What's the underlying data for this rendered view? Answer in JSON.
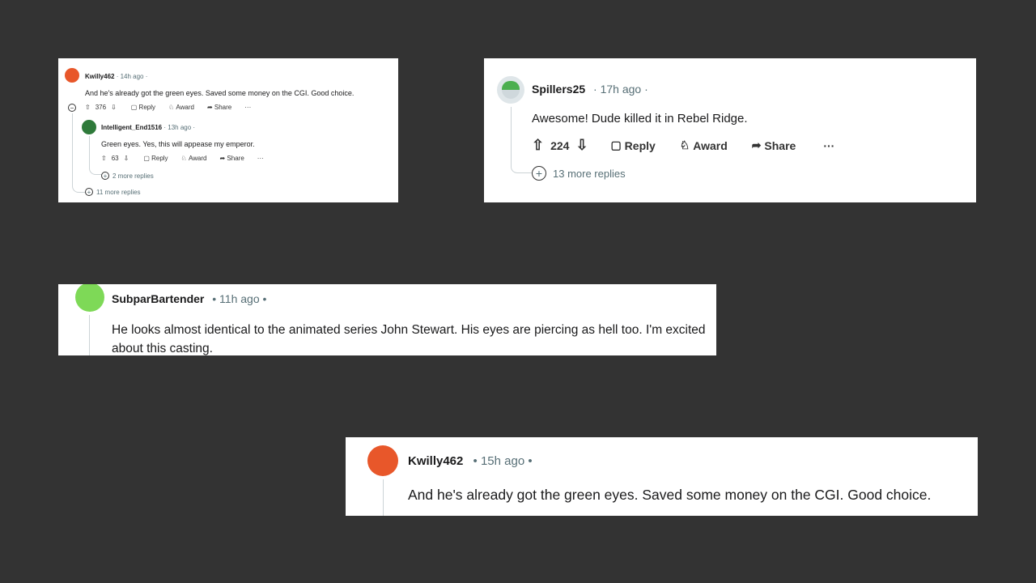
{
  "colors": {
    "background": "#333333",
    "card": "#ffffff",
    "meta": "#576f76"
  },
  "card1": {
    "comment": {
      "user": "Kwilly462",
      "time": "· 14h ago ·",
      "text": "And he's already got the green eyes. Saved some money on the CGI. Good choice.",
      "votes": "376",
      "reply": "Reply",
      "award": "Award",
      "share": "Share",
      "more": "···"
    },
    "reply": {
      "user": "Intelligent_End1516",
      "time": "· 13h ago ·",
      "text": "Green eyes. Yes, this will appease my emperor.",
      "votes": "63",
      "reply": "Reply",
      "award": "Award",
      "share": "Share",
      "more": "···",
      "more_replies": "2 more replies"
    },
    "more_replies": "11 more replies"
  },
  "card2": {
    "user": "Spillers25",
    "time": "· 17h ago ·",
    "text": "Awesome! Dude killed it in Rebel Ridge.",
    "votes": "224",
    "reply": "Reply",
    "award": "Award",
    "share": "Share",
    "more": "···",
    "more_replies": "13 more replies"
  },
  "card3": {
    "user": "SubparBartender",
    "time": "• 11h ago •",
    "text": "He looks almost identical to the animated series John Stewart. His eyes are piercing as hell too. I'm excited about this casting."
  },
  "card4": {
    "user": "Kwilly462",
    "time": "• 15h ago •",
    "text": "And he's already got the green eyes. Saved some money on the CGI. Good choice."
  }
}
